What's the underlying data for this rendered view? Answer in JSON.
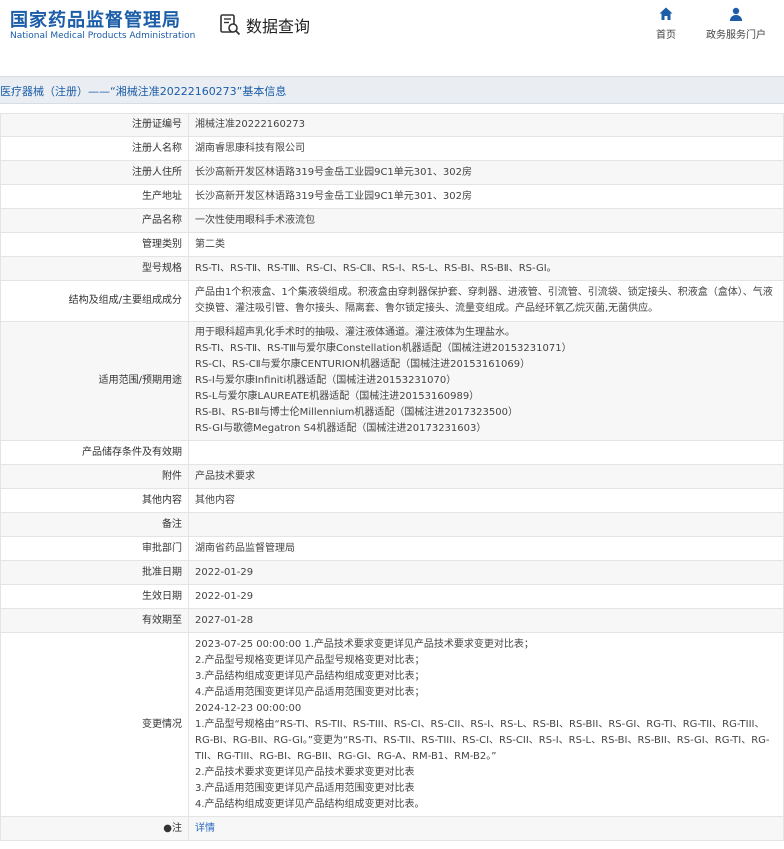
{
  "header": {
    "logo_cn": "国家药品监督管理局",
    "logo_en": "National Medical Products Administration",
    "query_title": "数据查询",
    "query_icon": "data-query-icon",
    "nav": [
      {
        "label": "首页",
        "icon": "home-icon"
      },
      {
        "label": "政务服务门户",
        "icon": "user-icon"
      }
    ],
    "brand_color": "#1c5da8"
  },
  "breadcrumb": "医疗器械（注册）——“湘械注准20222160273”基本信息",
  "rows": [
    {
      "label": "注册证编号",
      "value": [
        "湘械注准20222160273"
      ]
    },
    {
      "label": "注册人名称",
      "value": [
        "湖南睿思康科技有限公司"
      ]
    },
    {
      "label": "注册人住所",
      "value": [
        "长沙高新开发区林语路319号金岳工业园9C1单元301、302房"
      ]
    },
    {
      "label": "生产地址",
      "value": [
        "长沙高新开发区林语路319号金岳工业园9C1单元301、302房"
      ]
    },
    {
      "label": "产品名称",
      "value": [
        "一次性使用眼科手术液流包"
      ]
    },
    {
      "label": "管理类别",
      "value": [
        "第二类"
      ]
    },
    {
      "label": "型号规格",
      "value": [
        "RS-TⅠ、RS-TⅡ、RS-TⅢ、RS-CⅠ、RS-CⅡ、RS-Ⅰ、RS-L、RS-BⅠ、RS-BⅡ、RS-GⅠ。"
      ]
    },
    {
      "label": "结构及组成/主要组成成分",
      "value": [
        "产品由1个积液盒、1个集液袋组成。积液盒由穿刺器保护套、穿刺器、进液管、引流管、引流袋、锁定接头、积液盒（盒体）、气液交换管、灌注吸引管、鲁尔接头、隔离套、鲁尔锁定接头、流量变组成。产品经环氧乙烷灭菌,无菌供应。"
      ],
      "wrap": true
    },
    {
      "label": "适用范围/预期用途",
      "value": [
        "用于眼科超声乳化手术时的抽吸、灌注液体通道。灌注液体为生理盐水。",
        "RS-TⅠ、RS-TⅡ、RS-TⅢ与爱尔康Constellation机器适配（国械注进20153231071）",
        "RS-CⅠ、RS-CⅡ与爱尔康CENTURION机器适配（国械注进20153161069）",
        "RS-Ⅰ与爱尔康Infiniti机器适配（国械注进20153231070）",
        "RS-L与爱尔康LAUREATE机器适配（国械注进20153160989）",
        "RS-BⅠ、RS-BⅡ与博士伦Millennium机器适配（国械注进2017323500）",
        "RS-GⅠ与歌德Megatron S4机器适配（国械注进20173231603）"
      ]
    },
    {
      "label": "产品储存条件及有效期",
      "value": [
        ""
      ]
    },
    {
      "label": "附件",
      "value": [
        "产品技术要求"
      ]
    },
    {
      "label": "其他内容",
      "value": [
        "其他内容"
      ]
    },
    {
      "label": "备注",
      "value": [
        ""
      ]
    },
    {
      "label": "审批部门",
      "value": [
        "湖南省药品监督管理局"
      ]
    },
    {
      "label": "批准日期",
      "value": [
        "2022-01-29"
      ]
    },
    {
      "label": "生效日期",
      "value": [
        "2022-01-29"
      ]
    },
    {
      "label": "有效期至",
      "value": [
        "2027-01-28"
      ]
    },
    {
      "label": "变更情况",
      "value": [
        "2023-07-25 00:00:00 1.产品技术要求变更详见产品技术要求变更对比表；",
        "2.产品型号规格变更详见产品型号规格变更对比表；",
        "3.产品结构组成变更详见产品结构组成变更对比表；",
        "4.产品适用范围变更详见产品适用范围变更对比表；",
        "2024-12-23 00:00:00",
        "1.产品型号规格由“RS-TI、RS-TII、RS-TIII、RS-CI、RS-CII、RS-I、RS-L、RS-BI、RS-BII、RS-GI、RG-TI、RG-TII、RG-TIII、RG-BI、RG-BII、RG-GI。”变更为“RS-TI、RS-TII、RS-TIII、RS-CI、RS-CII、RS-I、RS-L、RS-BI、RS-BII、RS-GI、RG-TI、RG-TII、RG-TIII、RG-BI、RG-BII、RG-GI、RG-A、RM-B1、RM-B2。”",
        "2.产品技术要求变更详见产品技术要求变更对比表",
        "3.产品适用范围变更详见产品适用范围变更对比表",
        "4.产品结构组成变更详见产品结构组成变更对比表。"
      ],
      "wrap_index": 5
    }
  ],
  "note": {
    "label": "注",
    "icon": "lightbulb-icon",
    "link": "详情"
  }
}
